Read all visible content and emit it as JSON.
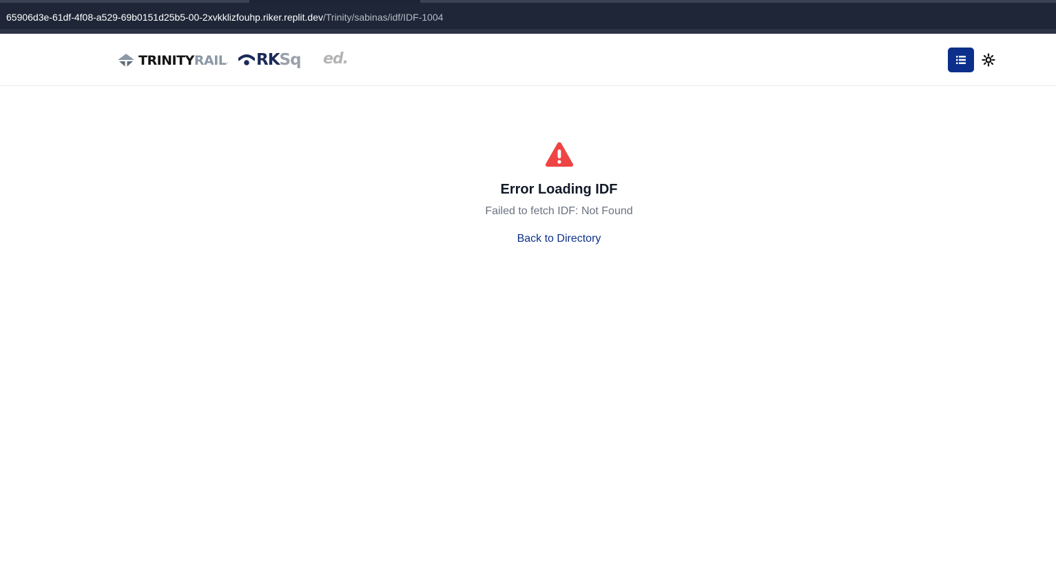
{
  "browser": {
    "url_host": "65906d3e-61df-4f08-a529-69b0151d25b5-00-2xvkklizfouhp.riker.replit.dev",
    "url_path": "/Trinity/sabinas/idf/IDF-1004"
  },
  "header": {
    "logos": {
      "trinity_part1": "TRINITY",
      "trinity_part2": "RAIL",
      "trinity_mark": ".",
      "rksq_part1": "RK",
      "rksq_part2": "Sq",
      "ed": "ed."
    },
    "menu_icon": "list-icon",
    "theme_icon": "sun-icon",
    "accent_color": "#0b2f8a"
  },
  "error": {
    "icon": "warning-triangle-icon",
    "icon_color": "#ef4444",
    "title": "Error Loading IDF",
    "message": "Failed to fetch IDF: Not Found",
    "back_link": "Back to Directory"
  }
}
